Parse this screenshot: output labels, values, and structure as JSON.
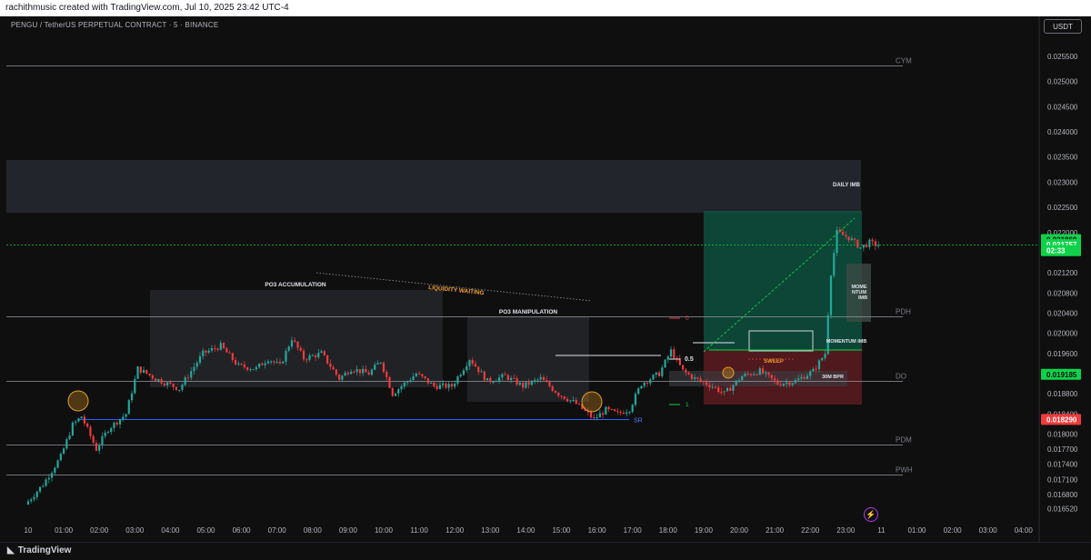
{
  "header": {
    "credit": "rachithmusic created with TradingView.com, Jul 10, 2025 23:42 UTC-4"
  },
  "symbol_line": "PENGU / TetherUS PERPETUAL CONTRACT · 5 · BINANCE",
  "currency_button": "USDT",
  "footer_logo": "TradingView",
  "colors": {
    "up": "#26a69a",
    "up_bright": "#0fd24a",
    "down": "#ef3b3b",
    "level_line": "#9598a1",
    "sr_line": "#2962ff",
    "annotation_orange": "#f0a030"
  },
  "chart_data": {
    "type": "candlestick",
    "interval": "5",
    "ylim": [
      0.01642,
      0.02575
    ],
    "time_range": [
      "10 00:00",
      "11 04:30"
    ],
    "y_ticks": [
      "0.025500",
      "0.025000",
      "0.024500",
      "0.024000",
      "0.023500",
      "0.023000",
      "0.022500",
      "0.022000",
      "0.021200",
      "0.020800",
      "0.020400",
      "0.020000",
      "0.019600",
      "0.018800",
      "0.018400",
      "0.018000",
      "0.017700",
      "0.017400",
      "0.017100",
      "0.016800",
      "0.016520"
    ],
    "x_ticks": [
      "10",
      "01:00",
      "02:00",
      "03:00",
      "04:00",
      "05:00",
      "06:00",
      "07:00",
      "08:00",
      "09:00",
      "10:00",
      "11:00",
      "12:00",
      "13:00",
      "14:00",
      "15:00",
      "16:00",
      "17:00",
      "18:00",
      "19:00",
      "20:00",
      "21:00",
      "22:00",
      "23:00",
      "11",
      "01:00",
      "02:00",
      "03:00",
      "04:00"
    ],
    "price_labels": [
      {
        "text": "0.021860",
        "value": 0.02186,
        "color": "#0fd24a",
        "text_color": "#0f0f0f"
      },
      {
        "text": "0.021757",
        "value": 0.02176,
        "color": "#0fd24a",
        "text_color": "#ffffff"
      },
      {
        "text": "02:33",
        "value": 0.02164,
        "color": "#0fd24a",
        "text_color": "#ffffff"
      },
      {
        "text": "0.019185",
        "value": 0.019185,
        "color": "#0fd24a",
        "text_color": "#0f0f0f"
      },
      {
        "text": "0.018290",
        "value": 0.01829,
        "color": "#ef3b3b",
        "text_color": "#ffffff"
      }
    ],
    "levels": [
      {
        "label": "CYM",
        "value": 0.02532
      },
      {
        "label": "PDH",
        "value": 0.02033
      },
      {
        "label": "DO",
        "value": 0.01906
      },
      {
        "label": "PDM",
        "value": 0.0178
      },
      {
        "label": "PWH",
        "value": 0.0172
      },
      {
        "label": "SR",
        "value": 0.01829
      }
    ],
    "annotations": {
      "daily_imb": "DAILY IMB",
      "po3_accumulation": "PO3 ACCUMULATION",
      "po3_manipulation": "PO3 MANIPULATION",
      "liquidity_waiting": "LIQUIDITY WAITING",
      "momentum_imb": "MOMENTUM IMB",
      "mome_line1": "MOME",
      "mome_line2": "NTUM",
      "mome_line3": "IMB",
      "sweep": "SWEEP",
      "bpr_30m": "30M BPR",
      "fib_0": "0",
      "fib_05": "0.5",
      "fib_1": "1"
    },
    "anchors": [
      {
        "t": "00:00",
        "p": 0.0166
      },
      {
        "t": "00:30",
        "p": 0.017
      },
      {
        "t": "01:00",
        "p": 0.01755
      },
      {
        "t": "01:20",
        "p": 0.01818
      },
      {
        "t": "01:35",
        "p": 0.01835
      },
      {
        "t": "02:00",
        "p": 0.0177
      },
      {
        "t": "02:20",
        "p": 0.0181
      },
      {
        "t": "02:50",
        "p": 0.0184
      },
      {
        "t": "03:10",
        "p": 0.0193
      },
      {
        "t": "03:40",
        "p": 0.0191
      },
      {
        "t": "04:20",
        "p": 0.0189
      },
      {
        "t": "05:00",
        "p": 0.0196
      },
      {
        "t": "05:30",
        "p": 0.01975
      },
      {
        "t": "06:00",
        "p": 0.01935
      },
      {
        "t": "06:30",
        "p": 0.0193
      },
      {
        "t": "06:50",
        "p": 0.0195
      },
      {
        "t": "07:10",
        "p": 0.01935
      },
      {
        "t": "07:30",
        "p": 0.0199
      },
      {
        "t": "07:50",
        "p": 0.0195
      },
      {
        "t": "08:20",
        "p": 0.0196
      },
      {
        "t": "08:50",
        "p": 0.0191
      },
      {
        "t": "09:10",
        "p": 0.0193
      },
      {
        "t": "09:40",
        "p": 0.0192
      },
      {
        "t": "10:00",
        "p": 0.01945
      },
      {
        "t": "10:20",
        "p": 0.0188
      },
      {
        "t": "10:40",
        "p": 0.019
      },
      {
        "t": "11:00",
        "p": 0.0192
      },
      {
        "t": "11:30",
        "p": 0.01895
      },
      {
        "t": "12:00",
        "p": 0.01895
      },
      {
        "t": "12:30",
        "p": 0.0195
      },
      {
        "t": "13:00",
        "p": 0.01905
      },
      {
        "t": "13:30",
        "p": 0.01915
      },
      {
        "t": "14:00",
        "p": 0.01895
      },
      {
        "t": "14:30",
        "p": 0.0191
      },
      {
        "t": "15:00",
        "p": 0.0188
      },
      {
        "t": "15:30",
        "p": 0.0186
      },
      {
        "t": "16:00",
        "p": 0.0183
      },
      {
        "t": "16:20",
        "p": 0.01848
      },
      {
        "t": "16:40",
        "p": 0.0184
      },
      {
        "t": "17:00",
        "p": 0.0185
      },
      {
        "t": "17:20",
        "p": 0.019
      },
      {
        "t": "17:50",
        "p": 0.0192
      },
      {
        "t": "18:10",
        "p": 0.01965
      },
      {
        "t": "18:30",
        "p": 0.01925
      },
      {
        "t": "18:50",
        "p": 0.0191
      },
      {
        "t": "19:20",
        "p": 0.01895
      },
      {
        "t": "19:40",
        "p": 0.0188
      },
      {
        "t": "20:10",
        "p": 0.01915
      },
      {
        "t": "20:40",
        "p": 0.01925
      },
      {
        "t": "21:10",
        "p": 0.019
      },
      {
        "t": "21:40",
        "p": 0.01905
      },
      {
        "t": "22:10",
        "p": 0.01925
      },
      {
        "t": "22:30",
        "p": 0.0196
      },
      {
        "t": "22:40",
        "p": 0.0212
      },
      {
        "t": "22:50",
        "p": 0.022
      },
      {
        "t": "23:10",
        "p": 0.0219
      },
      {
        "t": "23:30",
        "p": 0.0217
      },
      {
        "t": "23:45",
        "p": 0.0218
      },
      {
        "t": "23:55",
        "p": 0.02176
      }
    ]
  }
}
